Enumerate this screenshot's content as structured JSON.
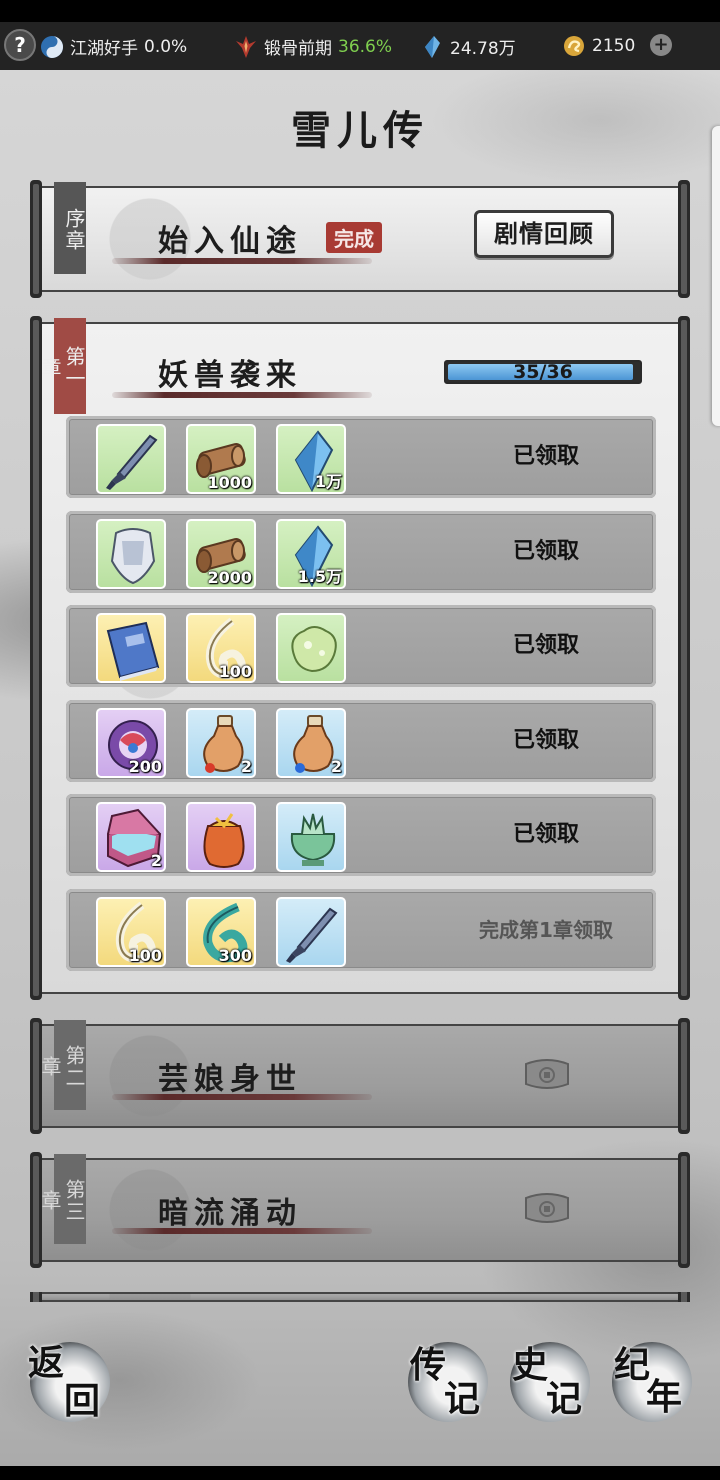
{
  "status_bar": {
    "stat1": {
      "icon": "yin-yang-icon",
      "label": "江湖好手",
      "value": "0.0%"
    },
    "stat2": {
      "icon": "flame-icon",
      "label": "锻骨前期",
      "value": "36.6%",
      "value_color": "#7fcf4f"
    },
    "stat3": {
      "icon": "crystal-icon",
      "value": "24.78万"
    },
    "stat4": {
      "icon": "coin-icon",
      "value": "2150"
    },
    "help_label": "?",
    "plus_label": "+"
  },
  "page_title": "雪儿传",
  "prologue": {
    "tag": "序章",
    "title": "始入仙途",
    "badge": "完成",
    "review_button": "剧情回顾"
  },
  "chapter1": {
    "tag": "第一章",
    "title": "妖兽袭来",
    "progress_text": "35/36",
    "progress_fraction": 0.972,
    "rows": [
      {
        "items": [
          {
            "icon": "sword-icon",
            "bg": "green",
            "qty": ""
          },
          {
            "icon": "scroll-icon",
            "bg": "green",
            "qty": "1000"
          },
          {
            "icon": "crystal-icon",
            "bg": "green",
            "qty": "1万"
          }
        ],
        "status": "已领取"
      },
      {
        "items": [
          {
            "icon": "armor-icon",
            "bg": "green",
            "qty": ""
          },
          {
            "icon": "scroll-icon",
            "bg": "green",
            "qty": "2000"
          },
          {
            "icon": "crystal-icon",
            "bg": "green",
            "qty": "1.5万"
          }
        ],
        "status": "已领取"
      },
      {
        "items": [
          {
            "icon": "book-icon",
            "bg": "yellow",
            "qty": ""
          },
          {
            "icon": "spirit-swirl-icon",
            "bg": "yellow",
            "qty": "100"
          },
          {
            "icon": "jade-ore-icon",
            "bg": "green",
            "qty": ""
          }
        ],
        "status": "已领取"
      },
      {
        "items": [
          {
            "icon": "orb-icon",
            "bg": "purple",
            "qty": "200"
          },
          {
            "icon": "red-potion-icon",
            "bg": "blue",
            "qty": "2"
          },
          {
            "icon": "blue-potion-icon",
            "bg": "blue",
            "qty": "2"
          }
        ],
        "status": "已领取"
      },
      {
        "items": [
          {
            "icon": "chest-icon",
            "bg": "purple",
            "qty": "2"
          },
          {
            "icon": "pouch-icon",
            "bg": "purple",
            "qty": ""
          },
          {
            "icon": "censer-icon",
            "bg": "blue",
            "qty": ""
          }
        ],
        "status": "已领取"
      },
      {
        "items": [
          {
            "icon": "spirit-swirl-icon",
            "bg": "yellow",
            "qty": "100"
          },
          {
            "icon": "water-swirl-icon",
            "bg": "yellow",
            "qty": "300"
          },
          {
            "icon": "sword-icon",
            "bg": "blue",
            "qty": ""
          }
        ],
        "status": "完成第1章领取"
      }
    ]
  },
  "chapter2": {
    "tag": "第二章",
    "title": "芸娘身世"
  },
  "chapter3": {
    "tag": "第三章",
    "title": "暗流涌动"
  },
  "bottom_nav": {
    "back": [
      "返",
      "回"
    ],
    "biography": [
      "传",
      "记"
    ],
    "history": [
      "史",
      "记"
    ],
    "chronicle": [
      "纪",
      "年"
    ]
  }
}
